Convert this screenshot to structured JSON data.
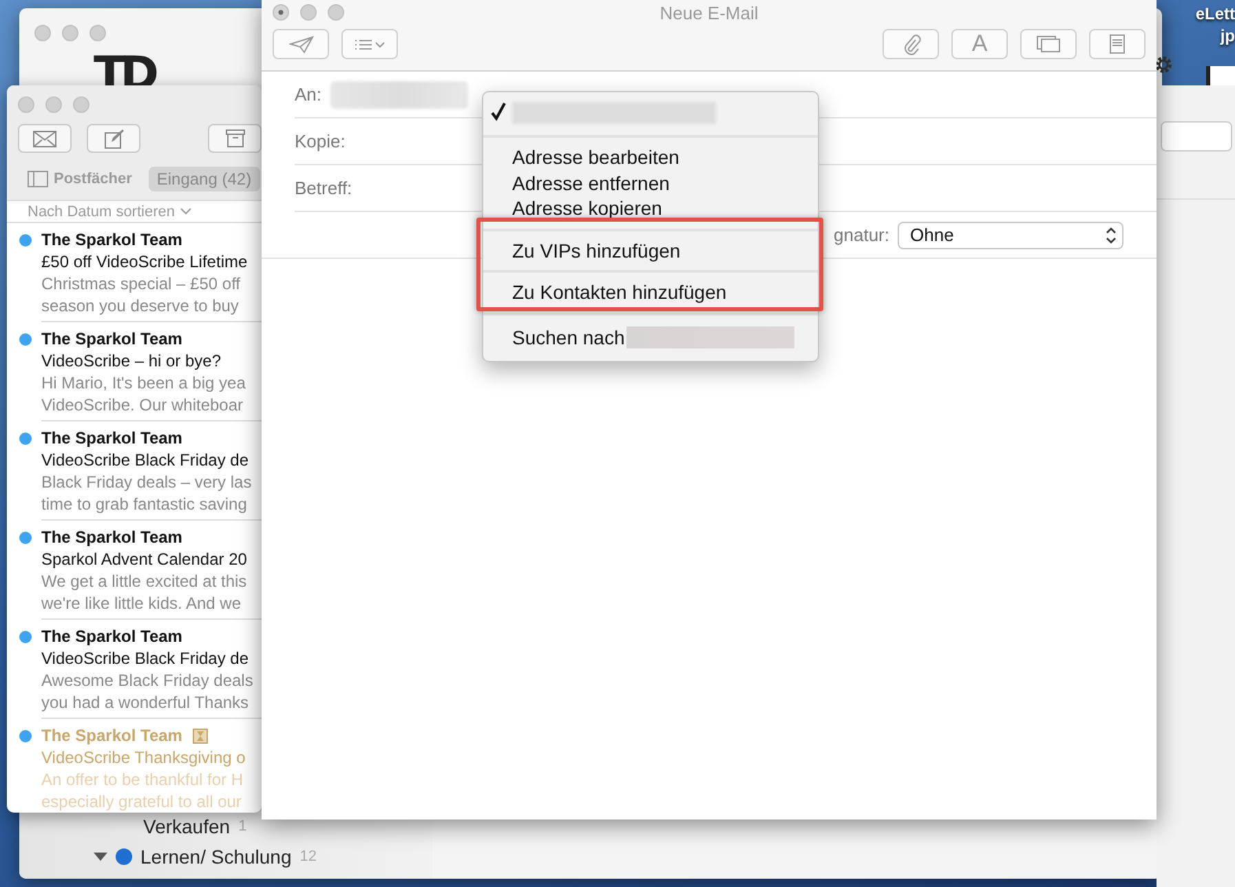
{
  "desktop": {
    "icon_label": [
      "eLett",
      "jp"
    ]
  },
  "background_window": {
    "logo": "TD",
    "folders": [
      {
        "kind": "item",
        "label": "Verkaufen",
        "count": "1"
      },
      {
        "kind": "group",
        "label": "Lernen/ Schulung",
        "count": "12",
        "color": "#1f6fd0"
      }
    ]
  },
  "mail_window": {
    "mailboxes_button": "Postfächer",
    "tabs": [
      {
        "label": "Eingang (42)",
        "selected": true
      }
    ],
    "sort": "Nach Datum sortieren",
    "messages": [
      {
        "sender": "The Sparkol Team",
        "subject": "£50 off VideoScribe Lifetime",
        "preview": [
          "Christmas special – £50 off",
          "season you deserve to buy"
        ],
        "unread": true,
        "dimmed": false
      },
      {
        "sender": "The Sparkol Team",
        "subject": "VideoScribe – hi or bye?",
        "preview": [
          "Hi Mario, It's been a big yea",
          "VideoScribe. Our whiteboar"
        ],
        "unread": true,
        "dimmed": false
      },
      {
        "sender": "The Sparkol Team",
        "subject": "VideoScribe Black Friday de",
        "preview": [
          "Black Friday deals – very las",
          "time to grab fantastic saving"
        ],
        "unread": true,
        "dimmed": false
      },
      {
        "sender": "The Sparkol Team",
        "subject": "Sparkol Advent Calendar 20",
        "preview": [
          "We get a little excited at this",
          "we're like little kids. And we"
        ],
        "unread": true,
        "dimmed": false
      },
      {
        "sender": "The Sparkol Team",
        "subject": "VideoScribe Black Friday de",
        "preview": [
          "Awesome Black Friday deals",
          "you had a wonderful Thanks"
        ],
        "unread": true,
        "dimmed": false
      },
      {
        "sender": "The Sparkol Team",
        "subject": "VideoScribe Thanksgiving o",
        "preview": [
          "An offer to be thankful for H",
          "especially grateful to all our"
        ],
        "unread": true,
        "dimmed": true
      }
    ]
  },
  "compose": {
    "title": "Neue E-Mail",
    "format_button": "A",
    "fields": [
      {
        "kind": "recipients",
        "label": "An:"
      },
      {
        "kind": "text",
        "label": "Kopie:"
      },
      {
        "kind": "text",
        "label": "Betreff:"
      }
    ],
    "signature": {
      "label": "gnatur:",
      "value": "Ohne"
    }
  },
  "context_menu": {
    "items": [
      {
        "kind": "redacted",
        "checked": true
      },
      {
        "kind": "separator"
      },
      {
        "kind": "item",
        "label": "Adresse bearbeiten",
        "checked": false
      },
      {
        "kind": "item",
        "label": "Adresse entfernen",
        "checked": false
      },
      {
        "kind": "item",
        "label": "Adresse kopieren",
        "checked": false
      },
      {
        "kind": "separator"
      },
      {
        "kind": "item",
        "label": "Zu VIPs hinzufügen",
        "checked": false
      },
      {
        "kind": "separator"
      },
      {
        "kind": "item",
        "label": "Zu Kontakten hinzufügen",
        "checked": false
      },
      {
        "kind": "separator"
      },
      {
        "kind": "search",
        "label": "Suchen nach",
        "checked": false
      }
    ]
  }
}
